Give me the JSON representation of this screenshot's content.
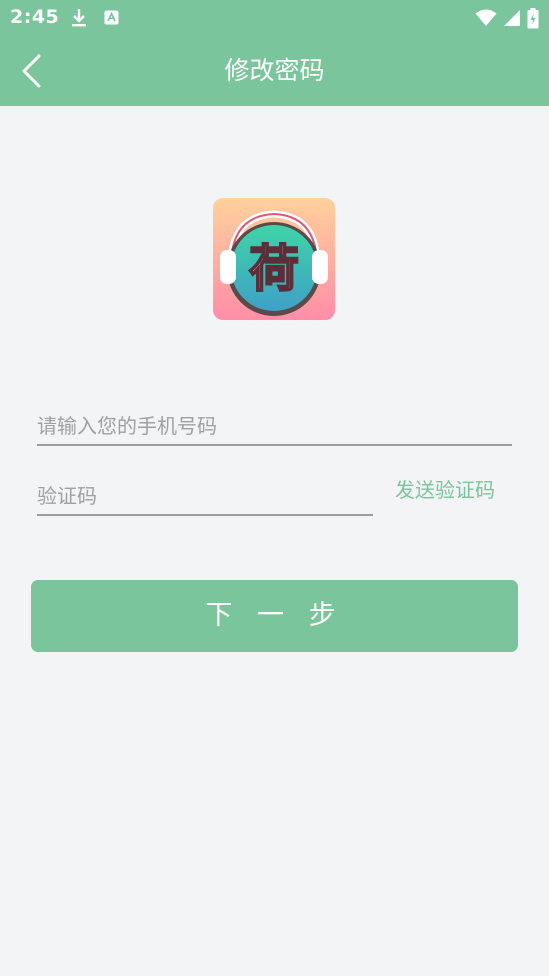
{
  "status_bar": {
    "time": "2:45",
    "icons": [
      "download-icon",
      "a-badge-icon",
      "wifi-icon",
      "signal-icon",
      "battery-charging-icon"
    ]
  },
  "app_bar": {
    "title": "修改密码",
    "back_icon": "chevron-left-icon"
  },
  "logo": {
    "glyph": "荷",
    "description_icon": "app-logo-headphones"
  },
  "form": {
    "phone_placeholder": "请输入您的手机号码",
    "phone_value": "",
    "code_placeholder": "验证码",
    "code_value": "",
    "send_code_label": "发送验证码"
  },
  "actions": {
    "next_label": "下 一 步"
  },
  "colors": {
    "primary": "#7bc59c",
    "background": "#f3f4f6",
    "underline": "#9c9c9c",
    "placeholder": "#a0a0a0"
  }
}
